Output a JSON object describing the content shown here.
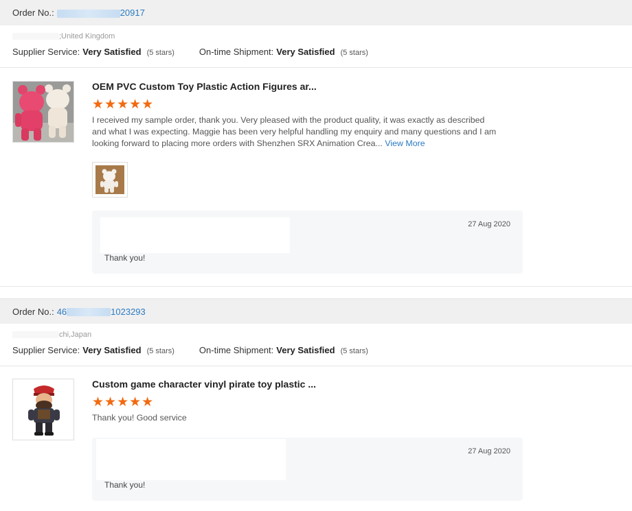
{
  "orders": [
    {
      "order_label": "Order No.:",
      "order_no_prefix": "",
      "order_no_suffix": "20917",
      "buyer_location": ";United Kingdom",
      "supplier_service_label": "Supplier Service:",
      "supplier_service_value": "Very Satisfied",
      "supplier_service_stars": "(5 stars)",
      "shipment_label": "On-time Shipment:",
      "shipment_value": "Very Satisfied",
      "shipment_stars": "(5 stars)",
      "product_title": "OEM PVC Custom Toy Plastic Action Figures ar...",
      "rating_stars": "★★★★★",
      "review_text": "I received my sample order, thank you. Very pleased with the product quality, it was exactly as described and what I was expecting. Maggie has been very helpful handling my enquiry and many questions and I am looking forward to placing more orders with Shenzhen SRX Animation Crea...",
      "view_more": "View More",
      "reply_date": "27 Aug 2020",
      "reply_text": "Thank you!"
    },
    {
      "order_label": "Order No.:",
      "order_no_prefix": "46",
      "order_no_suffix": "1023293",
      "buyer_location": "chi,Japan",
      "supplier_service_label": "Supplier Service:",
      "supplier_service_value": "Very Satisfied",
      "supplier_service_stars": "(5 stars)",
      "shipment_label": "On-time Shipment:",
      "shipment_value": "Very Satisfied",
      "shipment_stars": "(5 stars)",
      "product_title": "Custom game character vinyl pirate toy plastic ...",
      "rating_stars": "★★★★★",
      "review_text": "Thank you! Good service",
      "reply_date": "27 Aug 2020",
      "reply_text": "Thank you!"
    }
  ],
  "colors": {
    "star": "#f26a10",
    "link": "#2a7ac2",
    "header_bg": "#f0f0f0",
    "reply_bg": "#f6f7f9"
  },
  "icons": [
    "star-icon",
    "product-thumbnail-pink-bear-figures",
    "attachment-thumbnail-white-bear",
    "product-thumbnail-pirate-figure"
  ]
}
